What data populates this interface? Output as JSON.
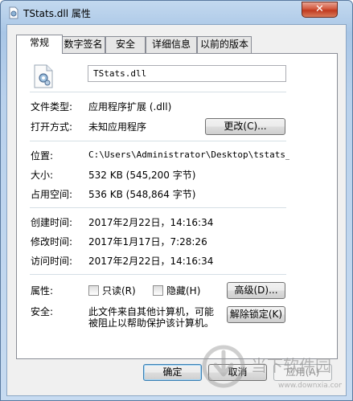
{
  "window": {
    "title": "TStats.dll 属性",
    "close_glyph": "✕"
  },
  "tabs": [
    {
      "label": "常规",
      "active": true
    },
    {
      "label": "数字签名",
      "active": false
    },
    {
      "label": "安全",
      "active": false
    },
    {
      "label": "详细信息",
      "active": false
    },
    {
      "label": "以前的版本",
      "active": false
    }
  ],
  "general": {
    "file_name": "TStats.dll",
    "file_type_label": "文件类型:",
    "file_type_value": "应用程序扩展 (.dll)",
    "opens_with_label": "打开方式:",
    "opens_with_value": "未知应用程序",
    "change_button": "更改(C)...",
    "location_label": "位置:",
    "location_value": "C:\\Users\\Administrator\\Desktop\\tstats_jz5",
    "size_label": "大小:",
    "size_value": "532 KB (545,200 字节)",
    "size_on_disk_label": "占用空间:",
    "size_on_disk_value": "536 KB (548,864 字节)",
    "created_label": "创建时间:",
    "created_value": "2017年2月22日，14:16:34",
    "modified_label": "修改时间:",
    "modified_value": "2017年1月17日，7:28:26",
    "accessed_label": "访问时间:",
    "accessed_value": "2017年2月22日，14:16:34",
    "attributes_label": "属性:",
    "readonly_label": "只读(R)",
    "readonly_checked": false,
    "hidden_label": "隐藏(H)",
    "hidden_checked": false,
    "advanced_button": "高级(D)...",
    "security_label": "安全:",
    "security_text_line1": "此文件来自其他计算机，可能",
    "security_text_line2": "被阻止以帮助保护该计算机。",
    "unblock_button": "解除锁定(K)"
  },
  "footer": {
    "ok_button": "确定",
    "cancel_button": "取消",
    "apply_button": "应用(A)"
  },
  "watermark": {
    "text": "当下软件园",
    "url_text": "www.downxia.com"
  }
}
